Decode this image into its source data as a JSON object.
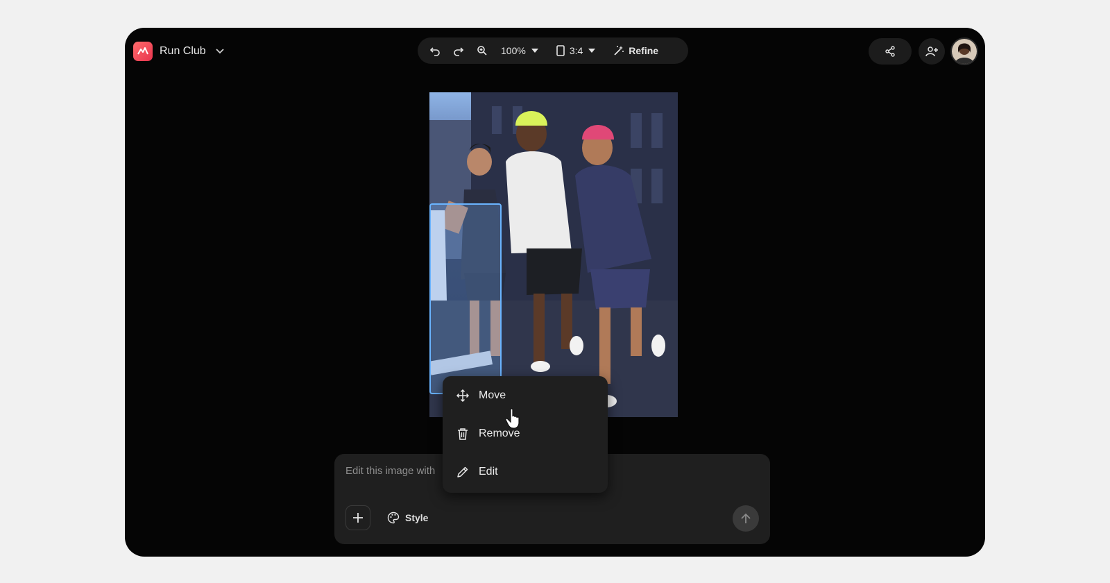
{
  "app": {
    "title": "Run Club"
  },
  "toolbar": {
    "zoom": "100%",
    "aspect": "3:4",
    "refine_label": "Refine"
  },
  "icons": {
    "logo": "app-logo-icon",
    "undo": "undo-icon",
    "redo": "redo-icon",
    "zoom": "zoom-in-icon",
    "aspect": "aspect-ratio-icon",
    "refine": "magic-wand-icon",
    "share": "share-icon",
    "add_person": "person-add-icon",
    "add": "plus-icon",
    "style": "palette-icon",
    "send": "arrow-up-icon"
  },
  "context_menu": {
    "items": [
      {
        "label": "Move",
        "icon": "move-icon"
      },
      {
        "label": "Remove",
        "icon": "trash-icon"
      },
      {
        "label": "Edit",
        "icon": "pencil-icon"
      }
    ]
  },
  "prompt": {
    "placeholder": "Edit this image with",
    "style_label": "Style"
  },
  "colors": {
    "accent_selection": "#6ab4ff",
    "window_bg": "#050505",
    "panel_bg": "#1f1f1f"
  }
}
